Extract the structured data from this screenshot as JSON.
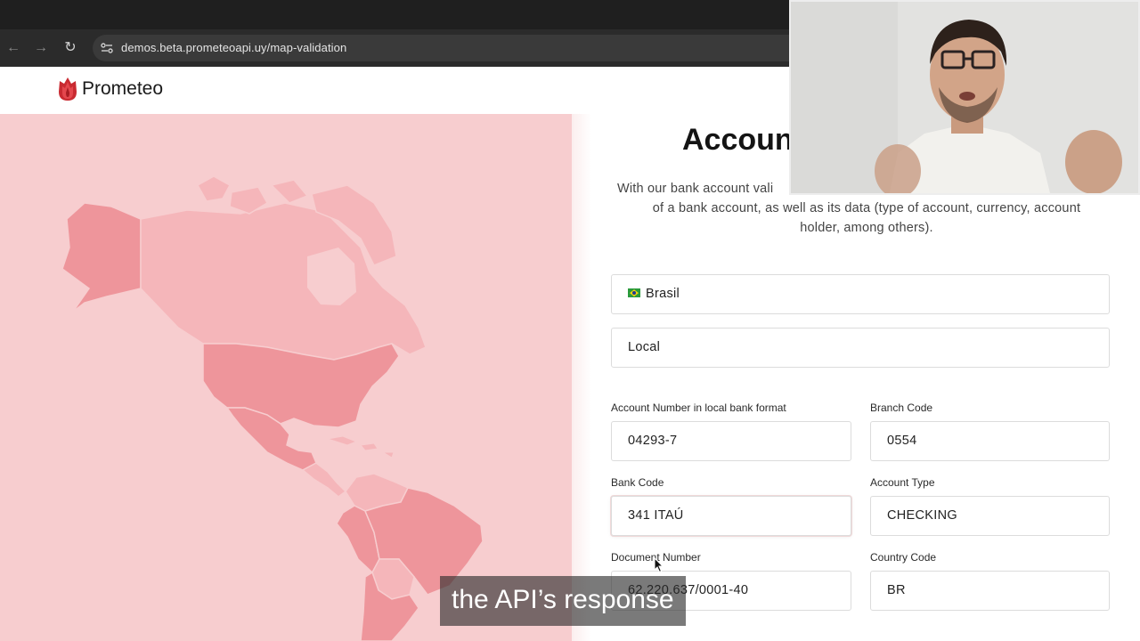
{
  "browser": {
    "url": "demos.beta.prometeoapi.uy/map-validation",
    "nav": {
      "back_icon": "←",
      "forward_icon": "→",
      "reload_icon": "↻"
    }
  },
  "brand": {
    "name": "Prometeo",
    "accent": "#d43a3f"
  },
  "page": {
    "title": "Accoun",
    "description_line1": "With our bank account vali",
    "description_line2": "of a bank account, as well as its data (type of account, currency, account",
    "description_line3": "holder, among others)."
  },
  "form": {
    "country": "Brasil",
    "account_scope": "Local",
    "account_number_label": "Account Number in local bank format",
    "account_number": "04293-7",
    "branch_code_label": "Branch Code",
    "branch_code": "0554",
    "bank_code_label": "Bank Code",
    "bank_code": "341 ITAÚ",
    "account_type_label": "Account Type",
    "account_type": "CHECKING",
    "document_number_label": "Document Number",
    "document_number": "62.220.637/0001-40",
    "country_code_label": "Country Code",
    "country_code": "BR"
  },
  "caption": {
    "text": "the API’s response"
  },
  "colors": {
    "map_bg": "#f7cdcf",
    "map_land_dark": "#ee959b",
    "map_land_light": "#f5b6ba",
    "browser_chrome": "#2b2b2b"
  }
}
